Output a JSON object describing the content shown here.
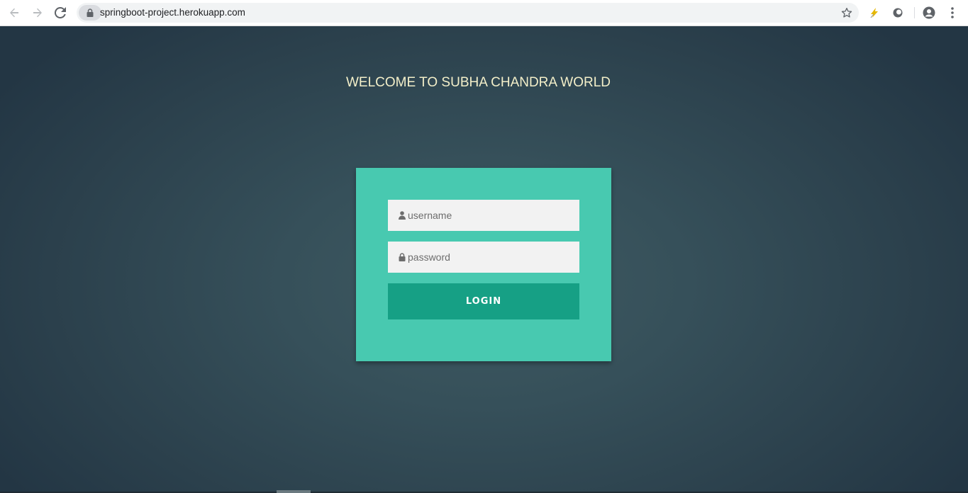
{
  "browser": {
    "url": "springboot-project.herokuapp.com",
    "icons": {
      "back": "arrow-left-icon",
      "forward": "arrow-right-icon",
      "reload": "reload-icon",
      "lock": "lock-icon",
      "bookmark": "star-icon",
      "extension1": "lightning-icon",
      "extension2": "circle-extension-icon",
      "profile": "account-icon",
      "menu": "kebab-menu-icon"
    }
  },
  "page": {
    "welcome_text": "WELCOME TO SUBHA CHANDRA WORLD",
    "login_form": {
      "username_placeholder": "username",
      "password_placeholder": "password",
      "login_label": "LOGIN"
    }
  },
  "colors": {
    "card": "#48c9b0",
    "button": "#16a085",
    "welcome_text": "#f3efc9",
    "background": "#2c3e47"
  }
}
